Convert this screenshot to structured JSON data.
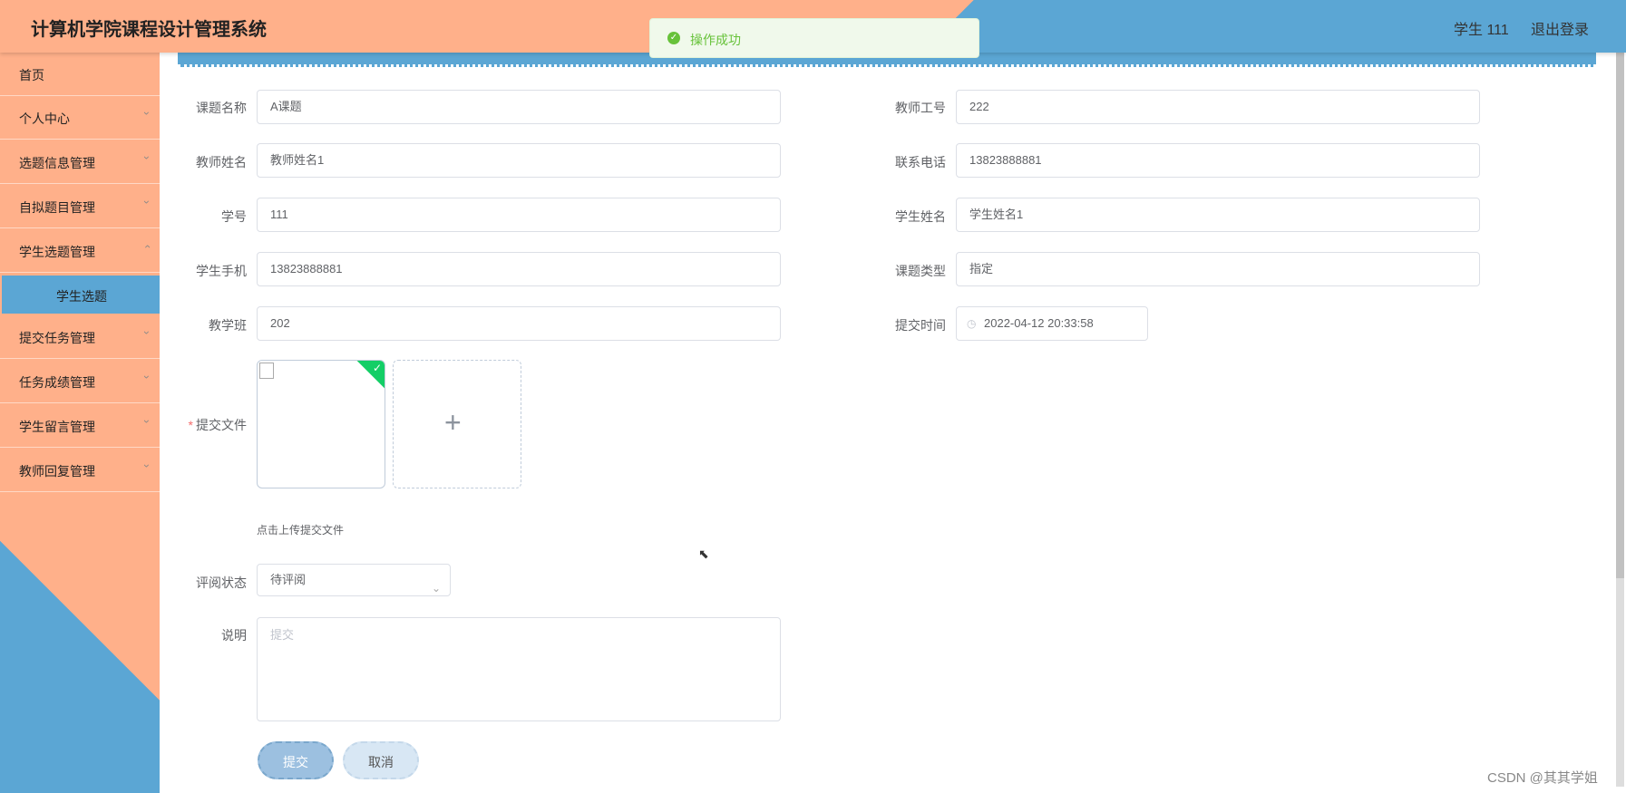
{
  "header": {
    "title": "计算机学院课程设计管理系统",
    "user": "学生 111",
    "logout": "退出登录"
  },
  "toast": {
    "message": "操作成功"
  },
  "sidebar": {
    "items": [
      {
        "label": "首页"
      },
      {
        "label": "个人中心"
      },
      {
        "label": "选题信息管理"
      },
      {
        "label": "自拟题目管理"
      },
      {
        "label": "学生选题管理"
      },
      {
        "label": "学生选题"
      },
      {
        "label": "提交任务管理"
      },
      {
        "label": "任务成绩管理"
      },
      {
        "label": "学生留言管理"
      },
      {
        "label": "教师回复管理"
      }
    ]
  },
  "form": {
    "topic_name": {
      "label": "课题名称",
      "value": "A课题"
    },
    "teacher_id": {
      "label": "教师工号",
      "value": "222"
    },
    "teacher_name": {
      "label": "教师姓名",
      "value": "教师姓名1"
    },
    "phone": {
      "label": "联系电话",
      "value": "13823888881"
    },
    "student_id": {
      "label": "学号",
      "value": "111"
    },
    "student_name": {
      "label": "学生姓名",
      "value": "学生姓名1"
    },
    "student_phone": {
      "label": "学生手机",
      "value": "13823888881"
    },
    "topic_type": {
      "label": "课题类型",
      "value": "指定"
    },
    "class": {
      "label": "教学班",
      "value": "202"
    },
    "submit_time": {
      "label": "提交时间",
      "value": "2022-04-12 20:33:58"
    },
    "file": {
      "label": "提交文件",
      "hint": "点击上传提交文件"
    },
    "review_status": {
      "label": "评阅状态",
      "value": "待评阅"
    },
    "note": {
      "label": "说明",
      "placeholder": "提交"
    },
    "submit_button": "提交",
    "cancel_button": "取消"
  },
  "watermark": "CSDN @其其学姐",
  "colors": {
    "accent_blue": "#5ba6d4",
    "accent_orange": "#ffb08a",
    "success": "#67c23a"
  }
}
